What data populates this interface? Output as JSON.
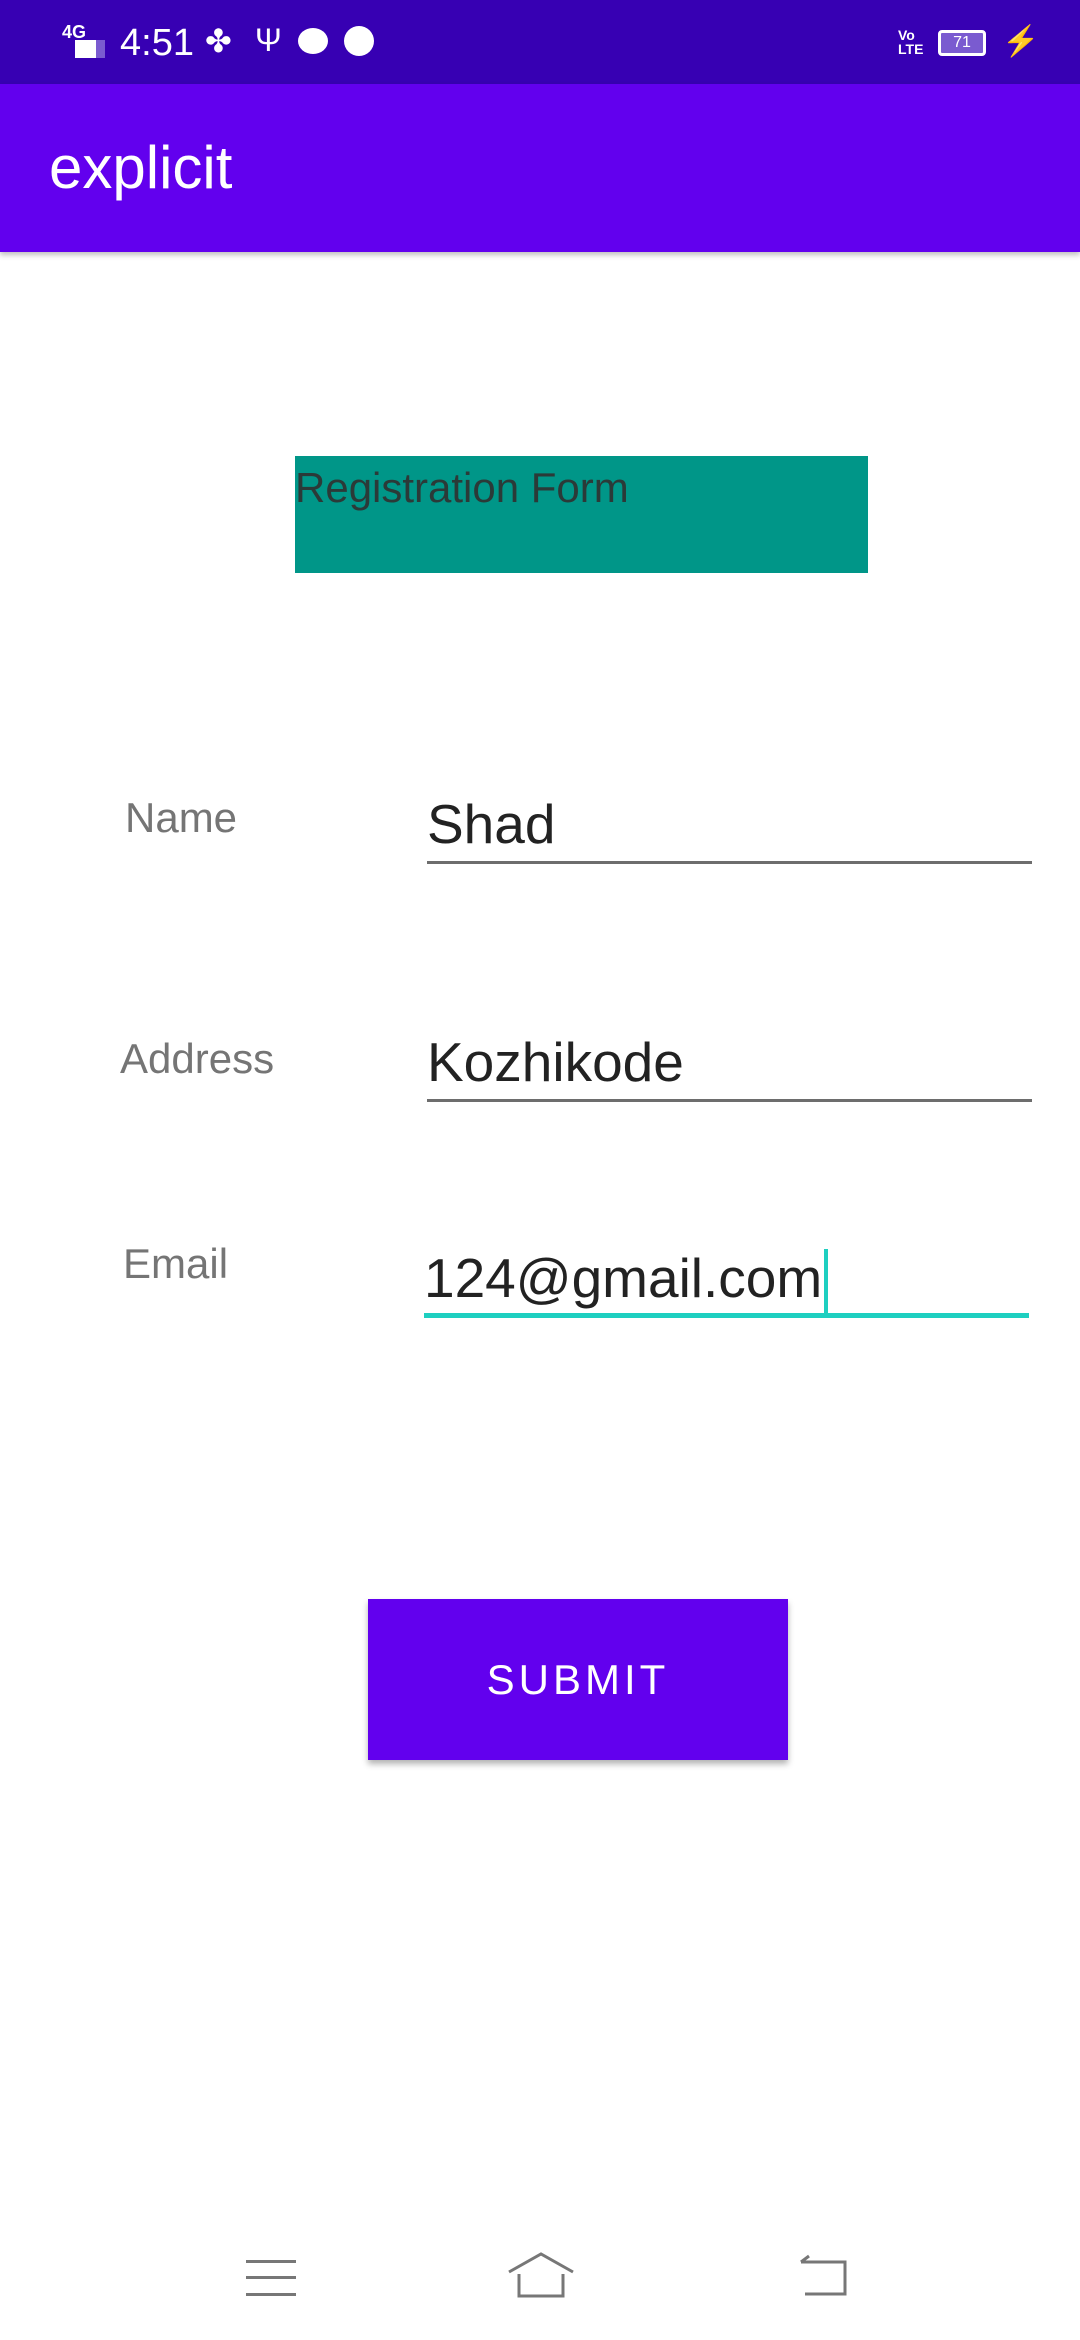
{
  "status_bar": {
    "network": "4G",
    "time": "4:51",
    "volte": "Vo LTE",
    "battery": "71"
  },
  "app_bar": {
    "title": "explicit"
  },
  "form": {
    "title": "Registration Form",
    "name": {
      "label": "Name",
      "value": "Shad"
    },
    "address": {
      "label": "Address",
      "value": "Kozhikode"
    },
    "email": {
      "label": "Email",
      "value": "124@gmail.com"
    },
    "submit_label": "SUBMIT"
  },
  "colors": {
    "primary": "#6200EE",
    "primary_dark": "#3700B3",
    "title_bg": "#009688",
    "focus_accent": "#1ECFC0"
  }
}
